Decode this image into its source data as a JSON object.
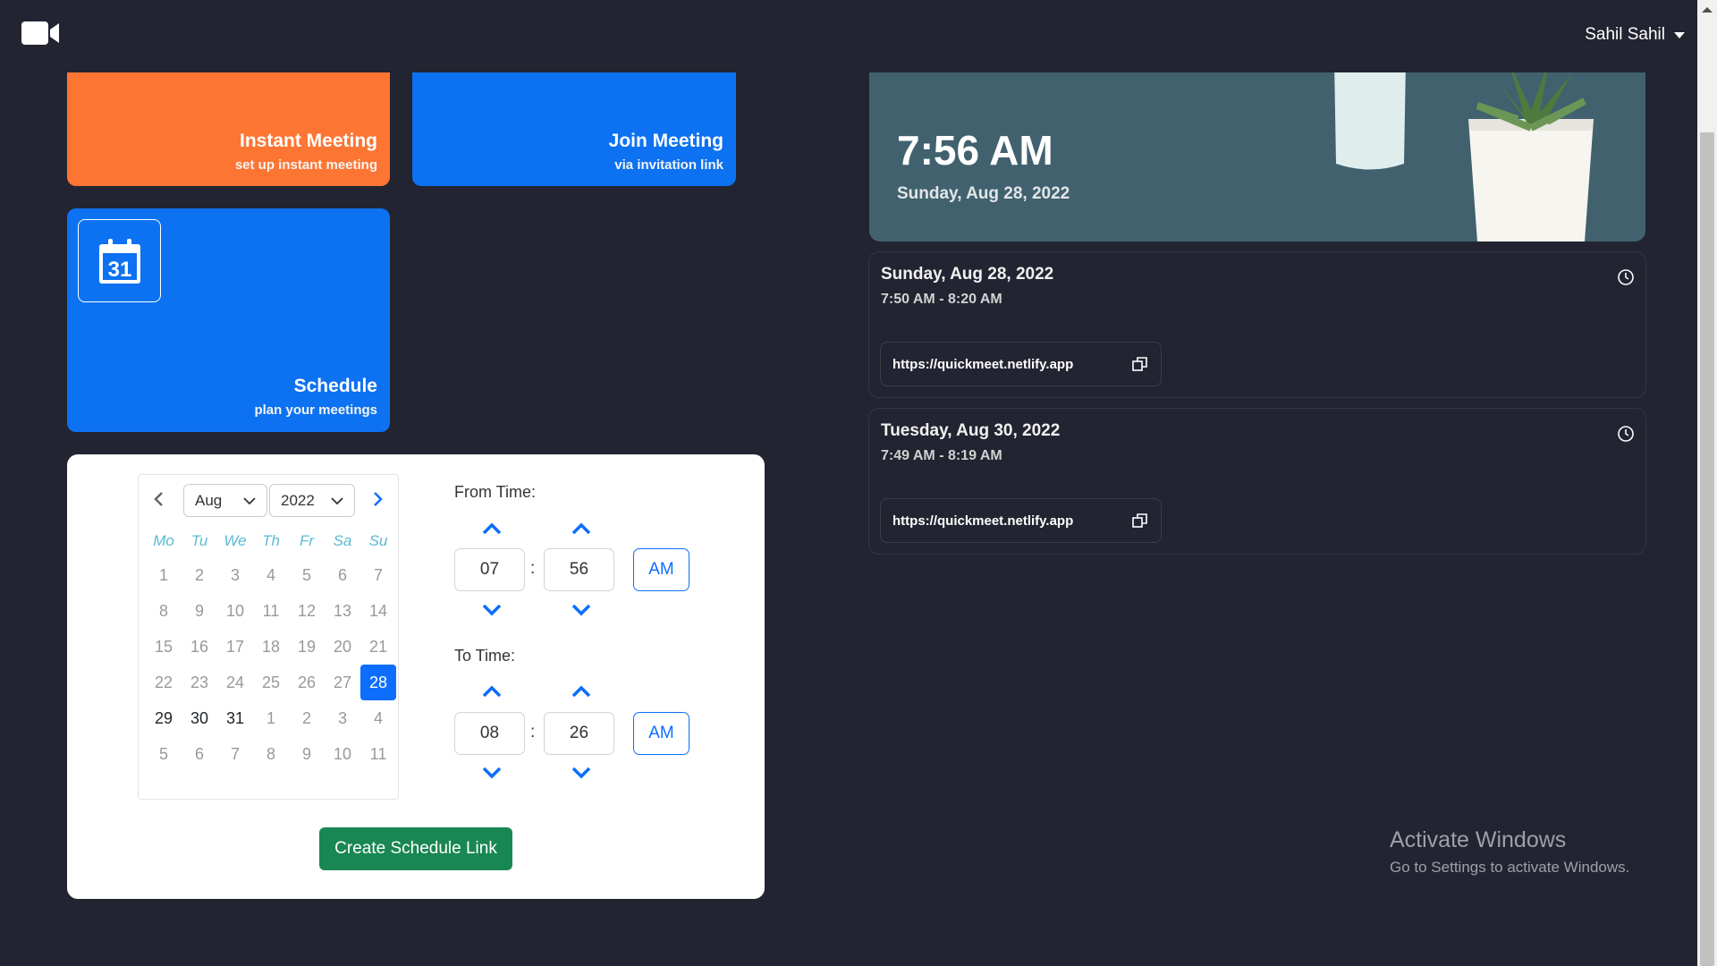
{
  "navbar": {
    "logo_icon": "video-camera-icon",
    "user_name": "Sahil Sahil"
  },
  "tiles": {
    "instant": {
      "title": "Instant Meeting",
      "subtitle": "set up instant meeting",
      "color": "#fd7532"
    },
    "join": {
      "title": "Join Meeting",
      "subtitle": "via invitation link",
      "color": "#0d72f1"
    },
    "schedule": {
      "title": "Schedule",
      "subtitle": "plan your meetings",
      "icon": "calendar-icon",
      "icon_text": "31",
      "color": "#0d72f1"
    }
  },
  "scheduler": {
    "month": "Aug",
    "year": "2022",
    "weekdays": [
      "Mo",
      "Tu",
      "We",
      "Th",
      "Fr",
      "Sa",
      "Su"
    ],
    "days": [
      {
        "n": "1",
        "t": "muted"
      },
      {
        "n": "2",
        "t": "muted"
      },
      {
        "n": "3",
        "t": "muted"
      },
      {
        "n": "4",
        "t": "muted"
      },
      {
        "n": "5",
        "t": "muted"
      },
      {
        "n": "6",
        "t": "muted"
      },
      {
        "n": "7",
        "t": "muted"
      },
      {
        "n": "8",
        "t": "muted"
      },
      {
        "n": "9",
        "t": "muted"
      },
      {
        "n": "10",
        "t": "muted"
      },
      {
        "n": "11",
        "t": "muted"
      },
      {
        "n": "12",
        "t": "muted"
      },
      {
        "n": "13",
        "t": "muted"
      },
      {
        "n": "14",
        "t": "muted"
      },
      {
        "n": "15",
        "t": "muted"
      },
      {
        "n": "16",
        "t": "muted"
      },
      {
        "n": "17",
        "t": "muted"
      },
      {
        "n": "18",
        "t": "muted"
      },
      {
        "n": "19",
        "t": "muted"
      },
      {
        "n": "20",
        "t": "muted"
      },
      {
        "n": "21",
        "t": "muted"
      },
      {
        "n": "22",
        "t": "muted"
      },
      {
        "n": "23",
        "t": "muted"
      },
      {
        "n": "24",
        "t": "muted"
      },
      {
        "n": "25",
        "t": "muted"
      },
      {
        "n": "26",
        "t": "muted"
      },
      {
        "n": "27",
        "t": "muted"
      },
      {
        "n": "28",
        "t": "selected"
      },
      {
        "n": "29",
        "t": "in"
      },
      {
        "n": "30",
        "t": "in"
      },
      {
        "n": "31",
        "t": "in"
      },
      {
        "n": "1",
        "t": "out"
      },
      {
        "n": "2",
        "t": "out"
      },
      {
        "n": "3",
        "t": "out"
      },
      {
        "n": "4",
        "t": "out"
      },
      {
        "n": "5",
        "t": "out"
      },
      {
        "n": "6",
        "t": "out"
      },
      {
        "n": "7",
        "t": "out"
      },
      {
        "n": "8",
        "t": "out"
      },
      {
        "n": "9",
        "t": "out"
      },
      {
        "n": "10",
        "t": "out"
      },
      {
        "n": "11",
        "t": "out"
      }
    ],
    "from_label": "From Time:",
    "from_hour": "07",
    "from_minute": "56",
    "from_ampm": "AM",
    "to_label": "To Time:",
    "to_hour": "08",
    "to_minute": "26",
    "to_ampm": "AM",
    "colon": ":",
    "create_button": "Create Schedule Link"
  },
  "clock": {
    "time": "7:56 AM",
    "date": "Sunday, Aug 28, 2022"
  },
  "meetings": [
    {
      "date": "Sunday, Aug 28, 2022",
      "range": "7:50 AM - 8:20 AM",
      "link": "https://quickmeet.netlify.app"
    },
    {
      "date": "Tuesday, Aug 30, 2022",
      "range": "7:49 AM - 8:19 AM",
      "link": "https://quickmeet.netlify.app"
    }
  ],
  "watermark": {
    "title": "Activate Windows",
    "subtitle": "Go to Settings to activate Windows."
  }
}
